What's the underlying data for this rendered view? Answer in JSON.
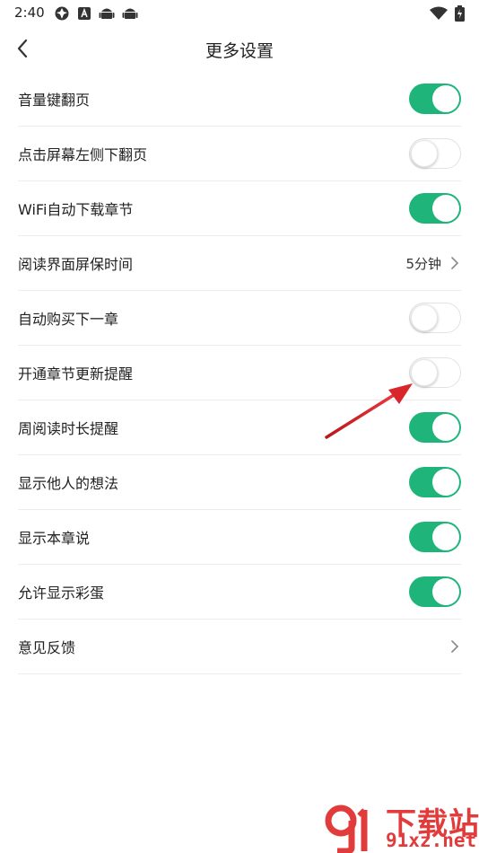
{
  "status_bar": {
    "time": "2:40",
    "icons": [
      "settings-gear-icon",
      "a-icon",
      "android-icon",
      "android-icon"
    ],
    "right_icons": [
      "wifi-icon",
      "battery-charging-icon"
    ]
  },
  "header": {
    "title": "更多设置",
    "back_icon": "chevron-left-icon"
  },
  "settings": [
    {
      "label": "音量键翻页",
      "type": "toggle",
      "on": true
    },
    {
      "label": "点击屏幕左侧下翻页",
      "type": "toggle",
      "on": false
    },
    {
      "label": "WiFi自动下载章节",
      "type": "toggle",
      "on": true
    },
    {
      "label": "阅读界面屏保时间",
      "type": "link",
      "value": "5分钟"
    },
    {
      "label": "自动购买下一章",
      "type": "toggle",
      "on": false
    },
    {
      "label": "开通章节更新提醒",
      "type": "toggle",
      "on": false
    },
    {
      "label": "周阅读时长提醒",
      "type": "toggle",
      "on": true
    },
    {
      "label": "显示他人的想法",
      "type": "toggle",
      "on": true
    },
    {
      "label": "显示本章说",
      "type": "toggle",
      "on": true
    },
    {
      "label": "允许显示彩蛋",
      "type": "toggle",
      "on": true
    },
    {
      "label": "意见反馈",
      "type": "link",
      "value": ""
    }
  ],
  "colors": {
    "toggle_on": "#1fb57a",
    "toggle_off_border": "#e2e2e2",
    "annotation_arrow": "#d8262a",
    "watermark": "#e13b3b"
  },
  "watermark": {
    "title": "下载站",
    "url": "91xz.net"
  }
}
